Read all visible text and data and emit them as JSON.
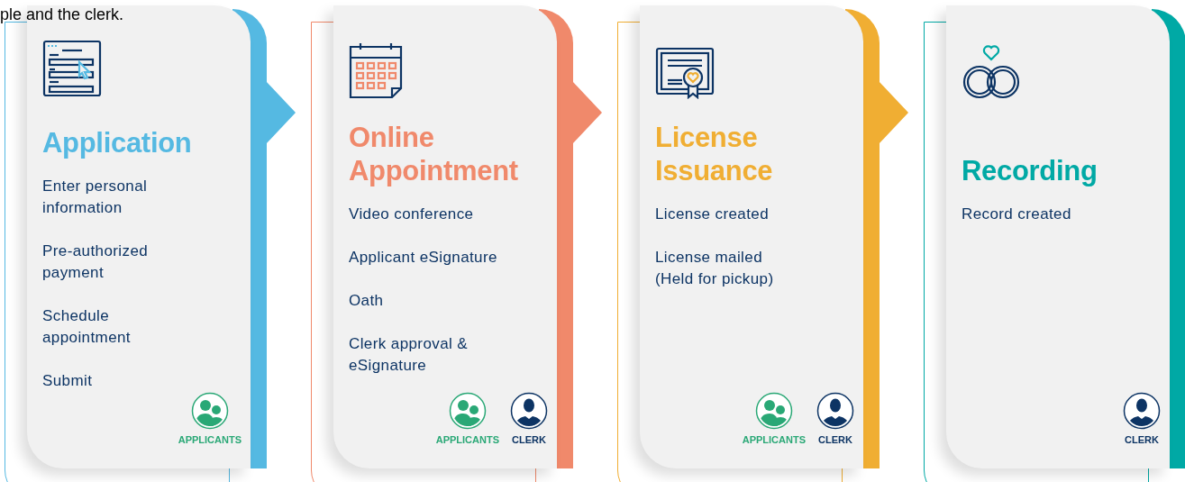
{
  "intro_fragment": "ple and the clerk.",
  "steps": [
    {
      "kind": "form",
      "title": "Application",
      "color": "#55b9e2",
      "items": [
        "Enter personal\ninformation",
        "Pre-authorized\npayment",
        "Schedule\nappointment",
        "Submit"
      ],
      "roles": [
        {
          "kind": "applicants",
          "label": "APPLICANTS"
        }
      ]
    },
    {
      "kind": "calendar",
      "title": "Online\nAppointment",
      "color": "#f0896b",
      "items": [
        "Video conference",
        "Applicant eSignature",
        "Oath",
        "Clerk approval &\neSignature"
      ],
      "roles": [
        {
          "kind": "applicants",
          "label": "APPLICANTS"
        },
        {
          "kind": "clerk",
          "label": "CLERK"
        }
      ]
    },
    {
      "kind": "certificate",
      "title": "License\nIssuance",
      "color": "#f0ae33",
      "items": [
        "License created",
        "License mailed\n(Held for pickup)"
      ],
      "roles": [
        {
          "kind": "applicants",
          "label": "APPLICANTS"
        },
        {
          "kind": "clerk",
          "label": "CLERK"
        }
      ]
    },
    {
      "kind": "rings",
      "title": "Recording",
      "color": "#00a9a5",
      "items": [
        "Record created"
      ],
      "roles": [
        {
          "kind": "clerk",
          "label": "CLERK"
        }
      ]
    }
  ]
}
